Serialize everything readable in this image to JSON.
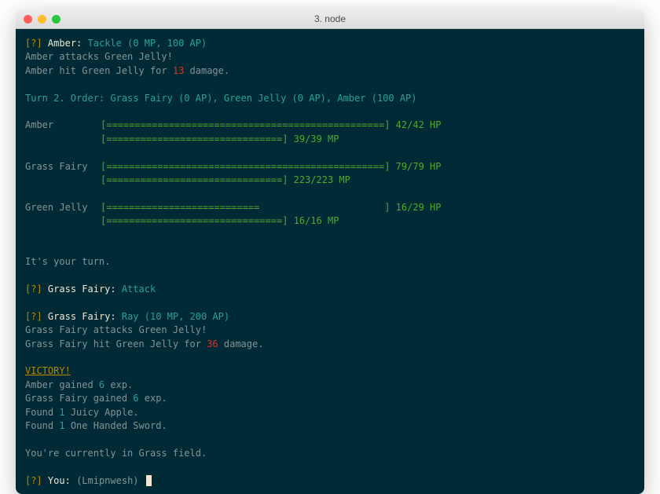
{
  "window": {
    "title": "3. node"
  },
  "prompt_marker": "[?]",
  "line1": {
    "actor": "Amber:",
    "skill": "Tackle (0 MP, 100 AP)"
  },
  "line2": "Amber attacks Green Jelly!",
  "line3_pre": "Amber hit Green Jelly for ",
  "line3_dmg": "13",
  "line3_post": " damage.",
  "turn_line": "Turn 2. Order: Grass Fairy (0 AP), Green Jelly (0 AP), Amber (100 AP)",
  "stats": [
    {
      "name": "Amber",
      "hp_bar": "[=================================================] 42/42 HP",
      "mp_bar": "[===============================] 39/39 MP"
    },
    {
      "name": "Grass Fairy",
      "hp_bar": "[=================================================] 79/79 HP",
      "mp_bar": "[===============================] 223/223 MP"
    },
    {
      "name": "Green Jelly",
      "hp_bar": "[===========================                      ] 16/29 HP",
      "mp_bar": "[===============================] 16/16 MP"
    }
  ],
  "your_turn": "It's your turn.",
  "gf_prompt1": {
    "actor": "Grass Fairy:",
    "choice": "Attack"
  },
  "gf_prompt2": {
    "actor": "Grass Fairy:",
    "choice": "Ray (10 MP, 200 AP)"
  },
  "gf_attack1": "Grass Fairy attacks Green Jelly!",
  "gf_attack2_pre": "Grass Fairy hit Green Jelly for ",
  "gf_attack2_dmg": "36",
  "gf_attack2_post": " damage.",
  "victory": "VICTORY!",
  "exp1_pre": "Amber gained ",
  "exp1_val": "6",
  "exp1_post": " exp.",
  "exp2_pre": "Grass Fairy gained ",
  "exp2_val": "6",
  "exp2_post": " exp.",
  "loot1_pre": "Found ",
  "loot1_qty": "1",
  "loot1_post": " Juicy Apple.",
  "loot2_pre": "Found ",
  "loot2_qty": "1",
  "loot2_post": " One Handed Sword.",
  "location": "You're currently in Grass field.",
  "input_prompt": {
    "actor": "You:",
    "hint": "(Lmipnwesh)"
  }
}
